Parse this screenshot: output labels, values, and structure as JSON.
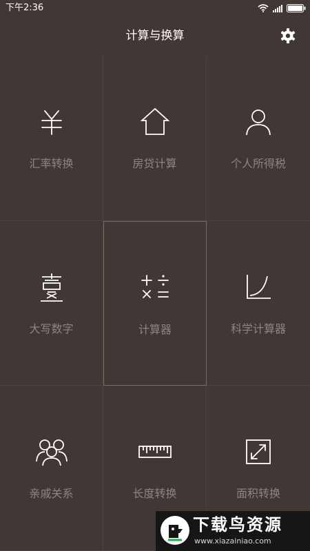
{
  "status_bar": {
    "time": "下午2:36"
  },
  "header": {
    "title": "计算与换算",
    "settings_icon": "gear-icon"
  },
  "tiles": [
    {
      "label": "汇率转换",
      "icon": "currency-icon"
    },
    {
      "label": "房贷计算",
      "icon": "house-icon"
    },
    {
      "label": "个人所得税",
      "icon": "person-icon"
    },
    {
      "label": "大写数字",
      "icon": "chinese-numeral-icon"
    },
    {
      "label": "计算器",
      "icon": "calculator-icon"
    },
    {
      "label": "科学计算器",
      "icon": "function-graph-icon"
    },
    {
      "label": "亲戚关系",
      "icon": "family-icon"
    },
    {
      "label": "长度转换",
      "icon": "ruler-icon"
    },
    {
      "label": "面积转换",
      "icon": "area-resize-icon"
    }
  ],
  "colors": {
    "background": "#413835",
    "grid_line": "#4d4441",
    "label": "#8e8480",
    "icon": "#ffffff",
    "selected_border": "#7a6a63"
  },
  "watermark": {
    "title": "下载鸟资源",
    "url": "www.xiazainiao.com"
  }
}
